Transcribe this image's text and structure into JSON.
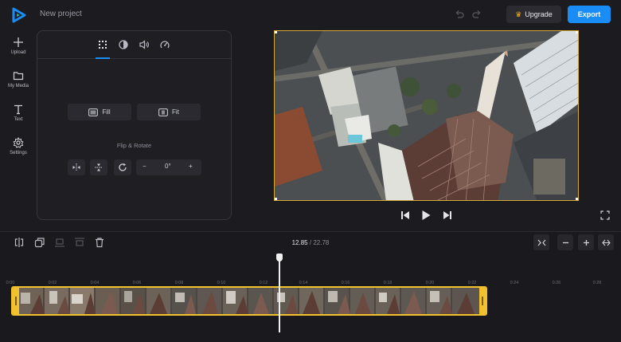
{
  "app": {
    "project_name": "New project"
  },
  "header": {
    "upgrade_label": "Upgrade",
    "export_label": "Export"
  },
  "sidebar": {
    "items": [
      {
        "label": "Upload",
        "icon": "plus-icon"
      },
      {
        "label": "My Media",
        "icon": "folder-icon"
      },
      {
        "label": "Text",
        "icon": "text-icon"
      },
      {
        "label": "Settings",
        "icon": "gear-icon"
      }
    ]
  },
  "panel": {
    "tabs": [
      {
        "icon": "crop-grid-icon",
        "active": true
      },
      {
        "icon": "contrast-icon",
        "active": false
      },
      {
        "icon": "volume-icon",
        "active": false
      },
      {
        "icon": "speed-icon",
        "active": false
      }
    ],
    "fill_label": "Fill",
    "fit_label": "Fit",
    "flip_rotate_title": "Flip & Rotate",
    "rotation_value": "0°"
  },
  "timeline": {
    "current_time": "12.85",
    "separator": "/",
    "total_time": "22.78",
    "ticks": [
      "0:00",
      "0:02",
      "0:04",
      "0:06",
      "0:08",
      "0:10",
      "0:12",
      "0:14",
      "0:16",
      "0:18",
      "0:20",
      "0:22",
      "0:24",
      "0:26",
      "0:28"
    ]
  },
  "colors": {
    "accent": "#1a8cf5",
    "selection": "#f2c12e",
    "background": "#1c1c20"
  }
}
